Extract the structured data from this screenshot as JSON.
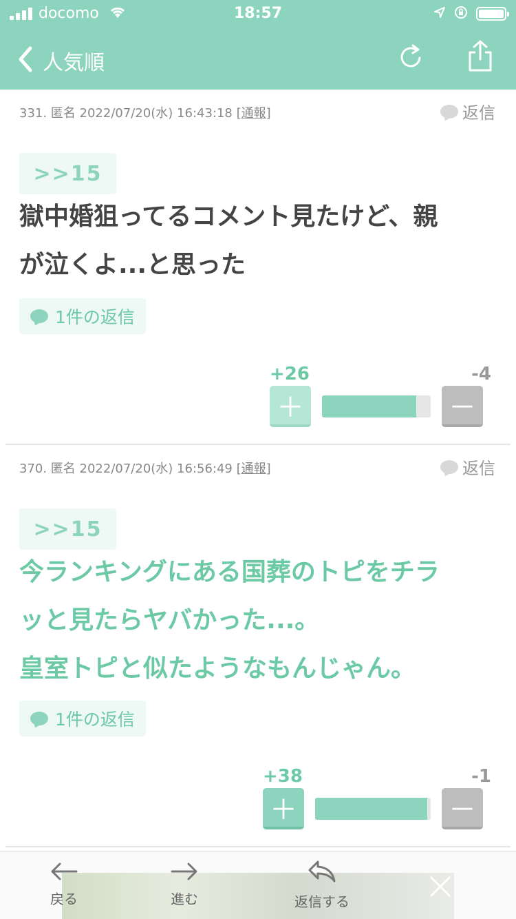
{
  "status_bar": {
    "carrier": "docomo",
    "time": "18:57"
  },
  "header": {
    "title": "人気順"
  },
  "comments": [
    {
      "meta": "331. 匿名 2022/07/20(水) 16:43:18",
      "report": "[通報]",
      "reply_label": "返信",
      "anchor": ">>15",
      "lines": [
        "獄中婚狙ってるコメント見たけど、親",
        "が泣くよ...と思った"
      ],
      "replies": "1件の返信",
      "plus": "+26",
      "minus": "-4",
      "plus_ratio": 0.87
    },
    {
      "meta": "370. 匿名 2022/07/20(水) 16:56:49",
      "report": "[通報]",
      "reply_label": "返信",
      "anchor": ">>15",
      "lines": [
        "今ランキングにある国葬のトピをチラ",
        "ッと見たらヤバかった...。",
        "皇室トピと似たようなもんじゃん。"
      ],
      "replies": "1件の返信",
      "plus": "+38",
      "minus": "-1",
      "plus_ratio": 0.97
    }
  ],
  "toolbar": {
    "back": "戻る",
    "forward": "進む",
    "reply": "返信する"
  },
  "colors": {
    "accent": "#8dd4be",
    "accent_text": "#6cc9a6",
    "grey": "#bdbdbd"
  }
}
